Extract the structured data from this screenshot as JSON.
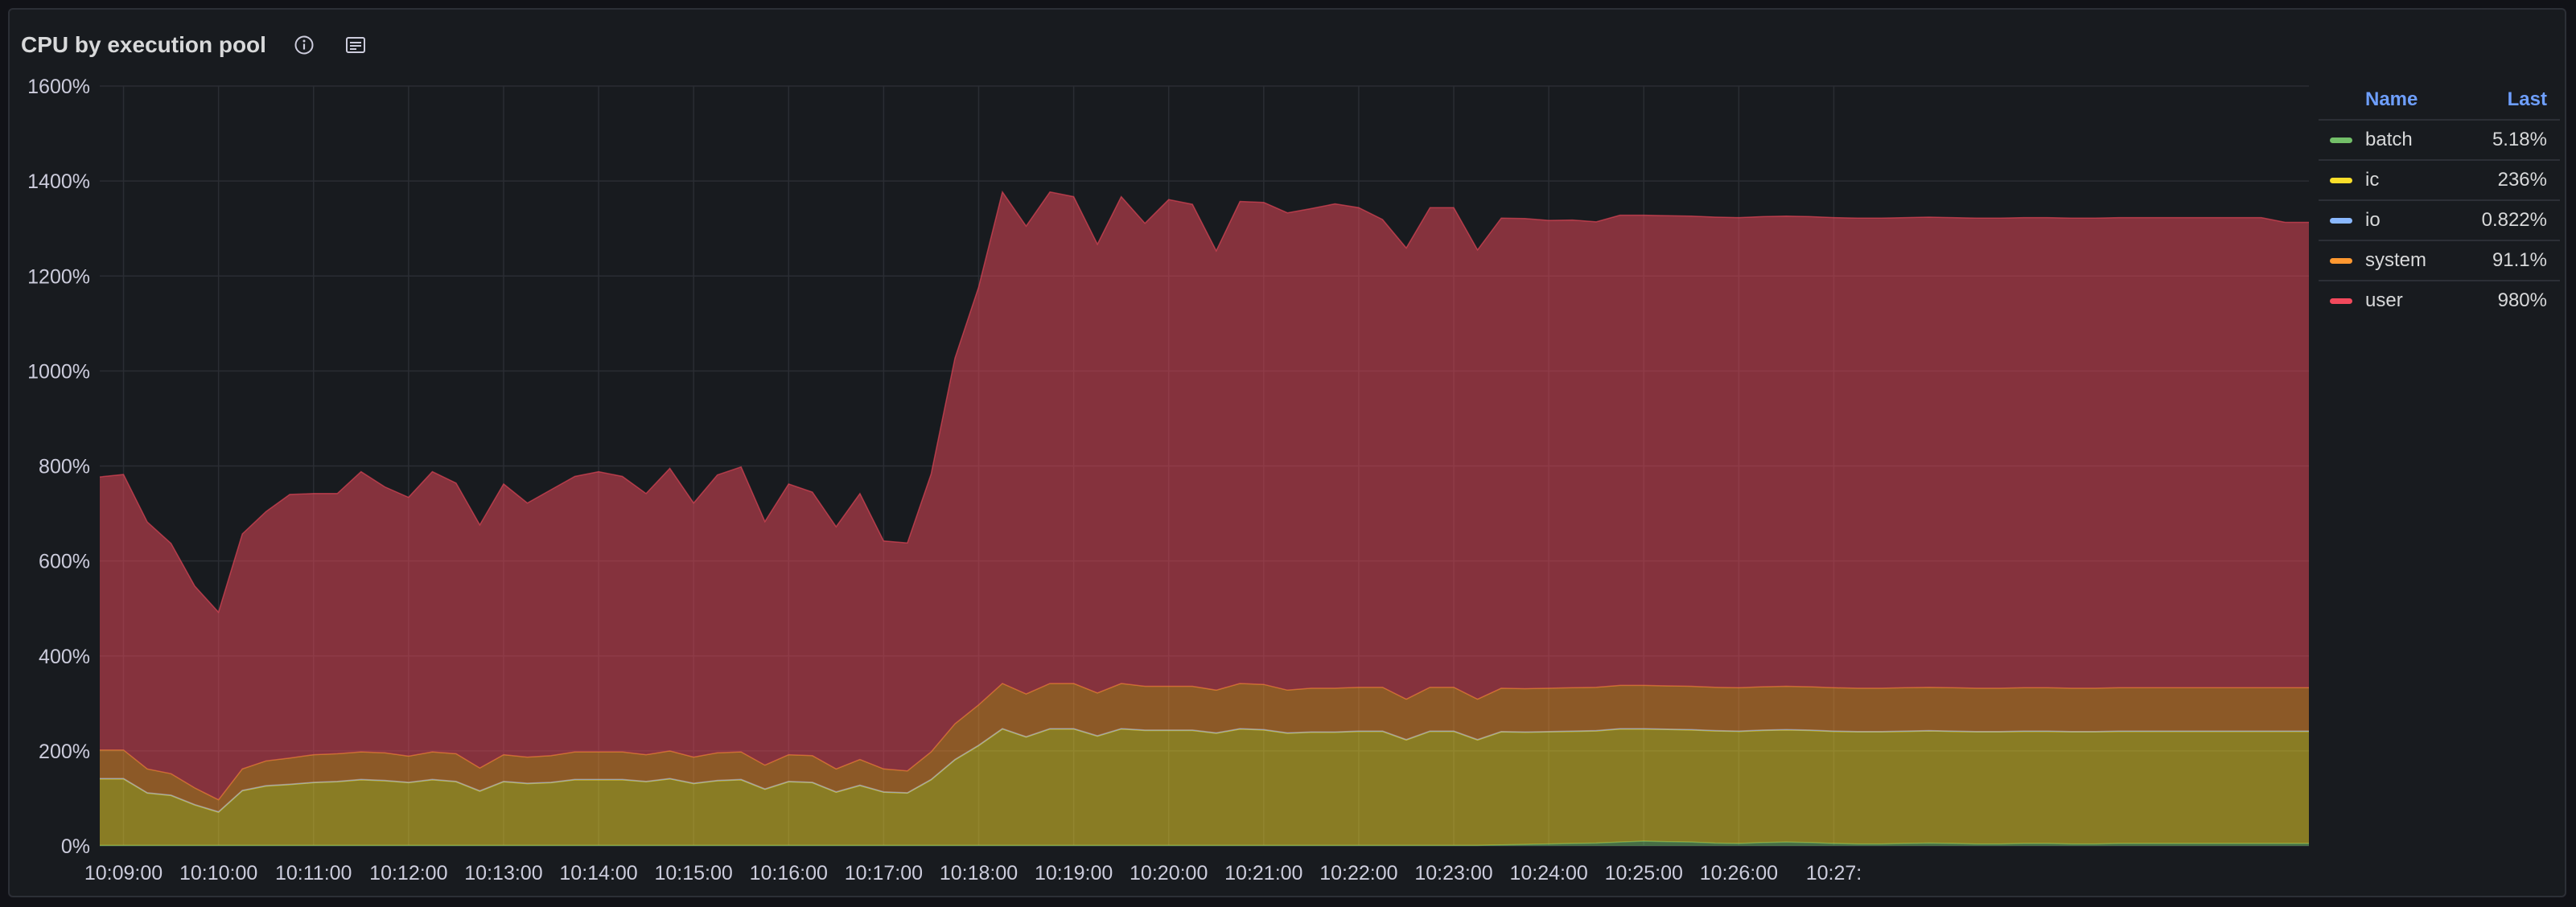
{
  "panel": {
    "title": "CPU by execution pool",
    "icons": [
      "info-icon",
      "description-icon"
    ]
  },
  "legend": {
    "columns": [
      "Name",
      "Last"
    ],
    "items": [
      {
        "name": "batch",
        "last": "5.18%",
        "color": "#73bf69"
      },
      {
        "name": "ic",
        "last": "236%",
        "color": "#fade2a"
      },
      {
        "name": "io",
        "last": "0.822%",
        "color": "#8ab8ff"
      },
      {
        "name": "system",
        "last": "91.1%",
        "color": "#ff9830"
      },
      {
        "name": "user",
        "last": "980%",
        "color": "#f2495c"
      }
    ]
  },
  "chart_data": {
    "type": "area",
    "stacked": true,
    "ylim": [
      0,
      1600
    ],
    "y_ticks": [
      "0%",
      "200%",
      "400%",
      "600%",
      "800%",
      "1000%",
      "1200%",
      "1400%",
      "1600%"
    ],
    "x_ticks": [
      "10:09:00",
      "10:10:00",
      "10:11:00",
      "10:12:00",
      "10:13:00",
      "10:14:00",
      "10:15:00",
      "10:16:00",
      "10:17:00",
      "10:18:00",
      "10:19:00",
      "10:20:00",
      "10:21:00",
      "10:22:00",
      "10:23:00",
      "10:24:00",
      "10:25:00",
      "10:26:00",
      "10:27:"
    ],
    "x_start": "10:08:45",
    "x_step_seconds": 15,
    "grid": true,
    "legend_position": "right",
    "series": [
      {
        "name": "batch",
        "color": "#73bf69",
        "values": [
          1,
          1,
          1,
          1,
          1,
          1,
          1,
          1,
          1,
          1,
          1,
          1,
          1,
          1,
          1,
          1,
          1,
          1,
          1,
          1,
          1,
          1,
          1,
          1,
          1,
          1,
          1,
          1,
          1,
          1,
          1,
          1,
          1,
          1,
          1,
          1,
          1,
          1,
          1,
          1,
          1,
          1,
          1,
          1,
          1,
          1,
          1,
          1,
          1,
          1,
          1,
          1,
          1,
          1,
          1,
          1,
          1,
          1,
          1,
          2,
          3,
          4,
          5,
          6,
          8,
          10,
          9,
          8,
          6,
          5,
          7,
          8,
          7,
          5,
          4,
          4,
          5,
          6,
          5,
          4,
          4,
          5,
          5,
          4,
          4,
          5,
          5,
          5,
          5,
          5,
          5,
          5,
          5,
          5
        ]
      },
      {
        "name": "ic",
        "color": "#fade2a",
        "values": [
          140,
          140,
          110,
          105,
          85,
          70,
          115,
          125,
          128,
          132,
          134,
          138,
          136,
          132,
          138,
          134,
          114,
          134,
          130,
          132,
          138,
          138,
          138,
          134,
          140,
          130,
          136,
          138,
          118,
          134,
          132,
          112,
          126,
          112,
          110,
          138,
          180,
          210,
          245,
          228,
          245,
          245,
          230,
          245,
          242,
          242,
          242,
          236,
          245,
          243,
          236,
          238,
          238,
          240,
          240,
          222,
          240,
          240,
          222,
          238,
          236,
          236,
          236,
          236,
          238,
          236,
          236,
          236,
          236,
          236,
          236,
          236,
          236,
          236,
          236,
          236,
          236,
          236,
          236,
          236,
          236,
          236,
          236,
          236,
          236,
          236,
          236,
          236,
          236,
          236,
          236,
          236,
          236,
          236
        ]
      },
      {
        "name": "io",
        "color": "#8ab8ff",
        "values": [
          1,
          1,
          1,
          1,
          1,
          1,
          1,
          1,
          1,
          1,
          1,
          1,
          1,
          1,
          1,
          1,
          1,
          1,
          1,
          1,
          1,
          1,
          1,
          1,
          1,
          1,
          1,
          1,
          1,
          1,
          1,
          1,
          1,
          1,
          1,
          1,
          1,
          1,
          1,
          1,
          1,
          1,
          1,
          1,
          1,
          1,
          1,
          1,
          1,
          1,
          1,
          1,
          1,
          1,
          1,
          1,
          1,
          1,
          1,
          1,
          1,
          1,
          1,
          1,
          1,
          1,
          1,
          1,
          1,
          1,
          1,
          1,
          1,
          1,
          1,
          1,
          1,
          1,
          1,
          1,
          1,
          1,
          1,
          1,
          1,
          1,
          1,
          1,
          1,
          1,
          1,
          1,
          1,
          1
        ]
      },
      {
        "name": "system",
        "color": "#ff9830",
        "values": [
          60,
          60,
          50,
          45,
          35,
          25,
          45,
          52,
          55,
          58,
          58,
          58,
          58,
          55,
          58,
          58,
          48,
          56,
          55,
          56,
          58,
          58,
          58,
          56,
          58,
          55,
          58,
          58,
          50,
          56,
          56,
          48,
          54,
          48,
          46,
          58,
          75,
          85,
          95,
          90,
          95,
          95,
          90,
          95,
          92,
          92,
          92,
          90,
          95,
          95,
          90,
          92,
          92,
          92,
          92,
          85,
          92,
          92,
          85,
          91,
          91,
          91,
          91,
          91,
          91,
          91,
          91,
          91,
          91,
          91,
          91,
          91,
          91,
          91,
          91,
          91,
          91,
          91,
          91,
          91,
          91,
          91,
          91,
          91,
          91,
          91,
          91,
          91,
          91,
          91,
          91,
          91,
          91,
          91
        ]
      },
      {
        "name": "user",
        "color": "#f2495c",
        "values": [
          575,
          580,
          520,
          485,
          425,
          395,
          495,
          525,
          555,
          550,
          548,
          590,
          560,
          545,
          590,
          570,
          512,
          570,
          535,
          560,
          580,
          590,
          580,
          550,
          595,
          535,
          585,
          600,
          513,
          570,
          555,
          510,
          560,
          480,
          480,
          585,
          770,
          880,
          1035,
          985,
          1035,
          1025,
          945,
          1025,
          975,
          1025,
          1015,
          925,
          1015,
          1015,
          1005,
          1010,
          1020,
          1010,
          985,
          950,
          1010,
          1010,
          946,
          990,
          990,
          985,
          985,
          980,
          990,
          990,
          990,
          990,
          990,
          990,
          990,
          990,
          990,
          990,
          990,
          990,
          990,
          990,
          990,
          990,
          990,
          990,
          990,
          990,
          990,
          990,
          990,
          990,
          990,
          990,
          990,
          990,
          980,
          980
        ]
      }
    ]
  }
}
